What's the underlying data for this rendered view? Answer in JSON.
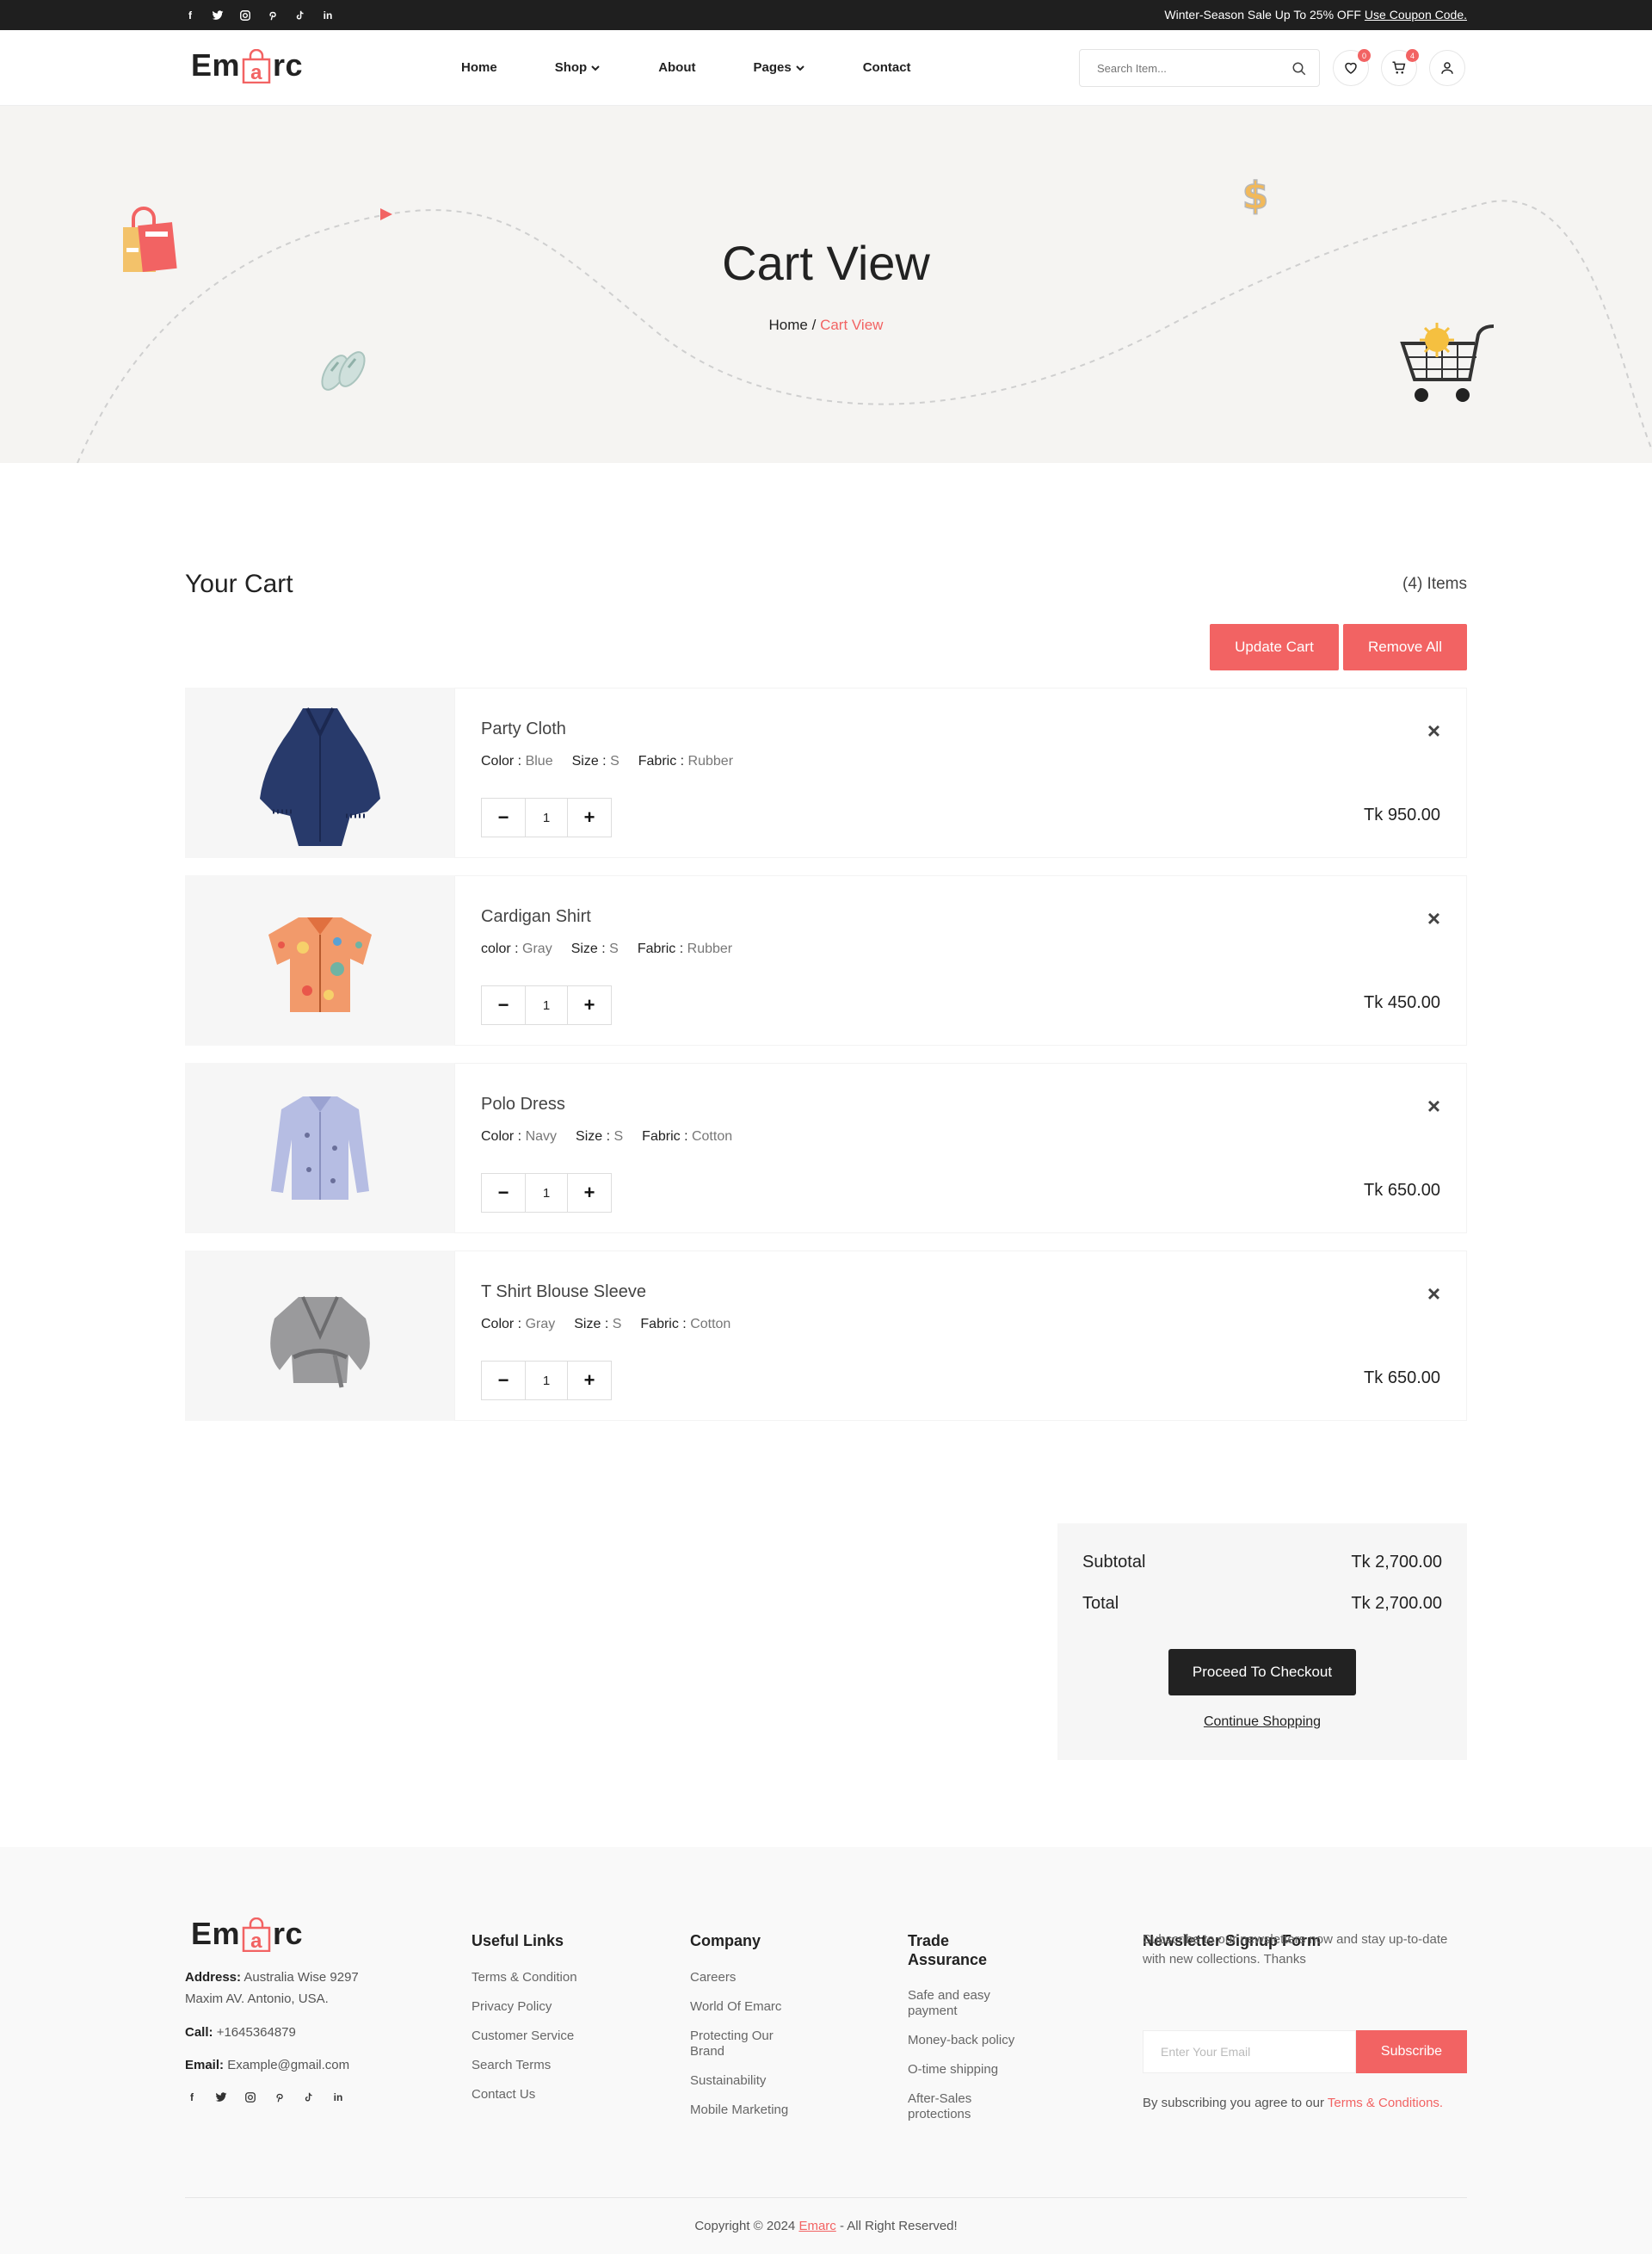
{
  "topbar": {
    "social_icons": [
      "facebook-icon",
      "twitter-icon",
      "instagram-icon",
      "pinterest-icon",
      "tiktok-icon",
      "linkedin-icon"
    ],
    "promo_text": "Winter-Season Sale Up To 25% OFF",
    "promo_link": "Use Coupon Code."
  },
  "header": {
    "logo_left": "Em",
    "logo_bag_letter": "a",
    "logo_right": "rc",
    "nav": [
      "Home",
      "Shop",
      "About",
      "Pages",
      "Contact"
    ],
    "search_placeholder": "Search Item...",
    "wishlist_count": "0",
    "cart_count": "4"
  },
  "banner": {
    "title": "Cart View",
    "crumb_home": "Home",
    "crumb_sep": " / ",
    "crumb_current": "Cart View"
  },
  "cart": {
    "title": "Your Cart",
    "count": "(4) Items",
    "update_label": "Update Cart",
    "remove_all_label": "Remove All",
    "items": [
      {
        "name": "Party Cloth",
        "color_label": "Color :",
        "color": "Blue",
        "size_label": "Size :",
        "size": "S",
        "fabric_label": "Fabric :",
        "fabric": "Rubber",
        "qty": "1",
        "price": "Tk 950.00"
      },
      {
        "name": "Cardigan Shirt",
        "color_label": "color :",
        "color": "Gray",
        "size_label": "Size :",
        "size": "S",
        "fabric_label": "Fabric :",
        "fabric": "Rubber",
        "qty": "1",
        "price": "Tk 450.00"
      },
      {
        "name": "Polo Dress",
        "color_label": "Color :",
        "color": "Navy",
        "size_label": "Size :",
        "size": "S",
        "fabric_label": "Fabric :",
        "fabric": "Cotton",
        "qty": "1",
        "price": "Tk 650.00"
      },
      {
        "name": "T Shirt Blouse Sleeve",
        "color_label": "Color :",
        "color": "Gray",
        "size_label": "Size :",
        "size": "S",
        "fabric_label": "Fabric :",
        "fabric": "Cotton",
        "qty": "1",
        "price": "Tk 650.00"
      }
    ]
  },
  "summary": {
    "subtotal_label": "Subtotal",
    "subtotal": "Tk 2,700.00",
    "total_label": "Total",
    "total": "Tk 2,700.00",
    "checkout_label": "Proceed To Checkout",
    "continue_label": "Continue Shopping"
  },
  "footer": {
    "address_label": "Address:",
    "address": "Australia Wise 9297 Maxim AV. Antonio, USA.",
    "call_label": "Call:",
    "call": "+1645364879",
    "email_label": "Email:",
    "email": "Example@gmail.com",
    "useful_title": "Useful Links",
    "useful": [
      "Terms & Condition",
      "Privacy Policy",
      "Customer Service",
      "Search Terms",
      "Contact Us"
    ],
    "company_title": "Company",
    "company": [
      "Careers",
      "World Of Emarc",
      "Protecting Our Brand",
      "Sustainability",
      "Mobile Marketing"
    ],
    "trade_title": "Trade Assurance",
    "trade": [
      "Safe and easy payment",
      "Money-back policy",
      "O-time shipping",
      "After-Sales protections"
    ],
    "newsletter_title": "Newsletter Signup Form",
    "newsletter_desc": "Subscribe to our newsletters now and stay up-to-date with new collections. Thanks",
    "newsletter_placeholder": "Enter Your Email",
    "subscribe_label": "Subscribe",
    "terms_prefix": "By subscribing you agree to our",
    "terms_link": "Terms & Conditions.",
    "copyright_prefix": "Copyright © 2024",
    "copyright_brand": "Emarc",
    "copyright_suffix": "- All Right Reserved!"
  },
  "colors": {
    "accent": "#f26363",
    "dark": "#1f1f1f",
    "light_bg": "#f6f6f6"
  }
}
